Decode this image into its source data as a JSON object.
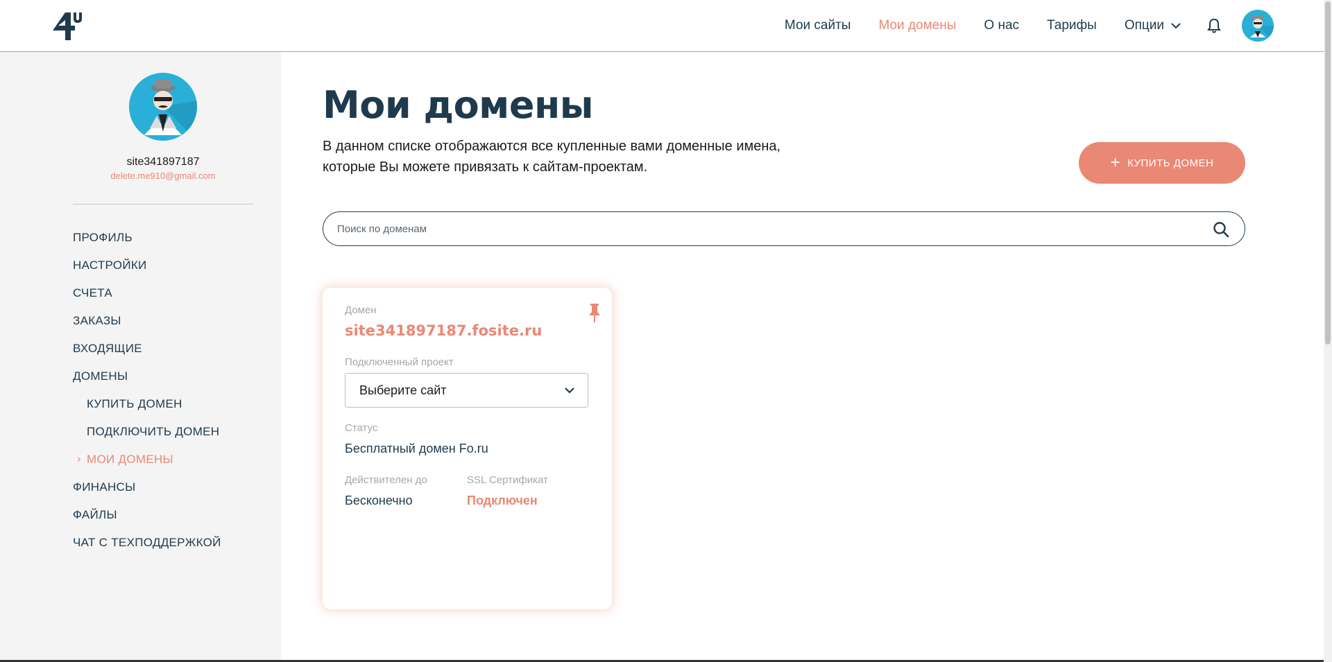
{
  "brand": {
    "logo_text": "4u",
    "accent": "#e98874",
    "dark": "#1f3a4d"
  },
  "nav": {
    "items": [
      {
        "label": "Мои сайты"
      },
      {
        "label": "Мои домены"
      },
      {
        "label": "О нас"
      },
      {
        "label": "Тарифы"
      }
    ],
    "options_label": "Опции",
    "icons": [
      "chevron-down-icon",
      "bell-icon",
      "avatar"
    ]
  },
  "sidebar": {
    "username": "site341897187",
    "email": "delete.me910@gmail.com",
    "menu": [
      {
        "label": "ПРОФИЛЬ"
      },
      {
        "label": "НАСТРОЙКИ"
      },
      {
        "label": "СЧЕТА"
      },
      {
        "label": "ЗАКАЗЫ"
      },
      {
        "label": "ВХОДЯЩИЕ"
      },
      {
        "label": "ДОМЕНЫ"
      },
      {
        "label": "КУПИТЬ ДОМЕН"
      },
      {
        "label": "ПОДКЛЮЧИТЬ ДОМЕН"
      },
      {
        "label": "МОИ ДОМЕНЫ"
      },
      {
        "label": "ФИНАНСЫ"
      },
      {
        "label": "ФАЙЛЫ"
      },
      {
        "label": "ЧАТ С ТЕХПОДДЕРЖКОЙ"
      }
    ],
    "current_caret": "›"
  },
  "main": {
    "title": "Мои домены",
    "description_line1": "В данном списке отображаются все купленные вами доменные имена,",
    "description_line2": "которые Вы можете привязать к сайтам-проектам.",
    "buy_button": {
      "icon": "+",
      "label": "КУПИТЬ ДОМЕН"
    },
    "search": {
      "placeholder": "Поиск по доменам",
      "value": ""
    }
  },
  "card": {
    "domain_label": "Домен",
    "domain": "site341897187.fosite.ru",
    "project_label": "Подключенный проект",
    "project_select": "Выберите сайт",
    "status_label": "Статус",
    "status": "Бесплатный домен Fo.ru",
    "valid_label": "Действителен до",
    "valid": "Бесконечно",
    "ssl_label": "SSL Сертификат",
    "ssl": "Подключен"
  }
}
